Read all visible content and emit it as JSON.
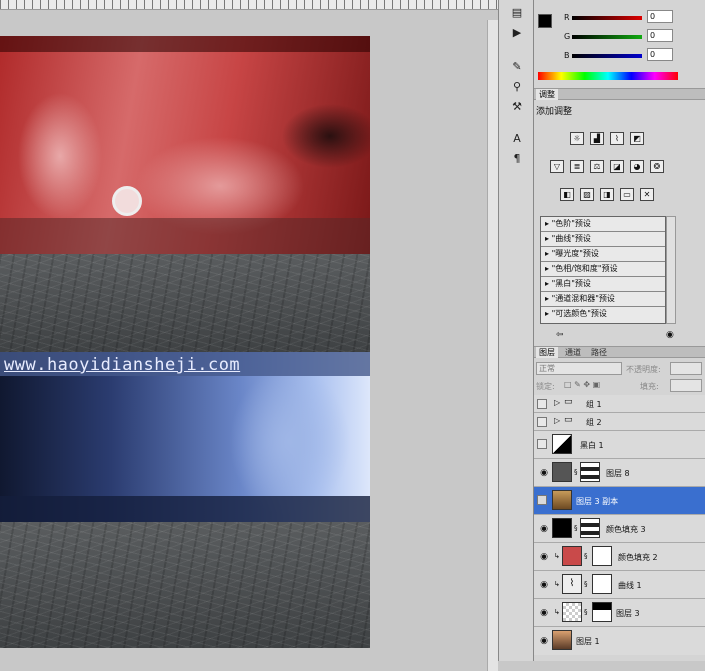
{
  "canvas": {
    "watermark": "www.haoyidiansheji.com"
  },
  "tools": {
    "icons": [
      "history-icon",
      "actions-icon",
      "brush-presets-icon",
      "clone-source-icon",
      "tool-presets-icon",
      "character-icon",
      "paragraph-icon"
    ]
  },
  "color_panel": {
    "fg_color": "#000000",
    "bg_color": "#ffffff",
    "channels": [
      {
        "label": "R",
        "value": "0"
      },
      {
        "label": "G",
        "value": "0"
      },
      {
        "label": "B",
        "value": "0"
      }
    ]
  },
  "adjustments_panel": {
    "tab": "调整",
    "title": "添加调整",
    "presets": [
      "\"色阶\"预设",
      "\"曲线\"预设",
      "\"曝光度\"预设",
      "\"色相/饱和度\"预设",
      "\"黑白\"预设",
      "\"通道混和器\"预设",
      "\"可选颜色\"预设"
    ]
  },
  "layers_panel": {
    "tabs": [
      "图层",
      "通道",
      "路径"
    ],
    "blend_mode": "正常",
    "opacity_label": "不透明度:",
    "lock_label": "锁定:",
    "fill_label": "填充:",
    "layers": [
      {
        "name": "组 1",
        "visible": false,
        "type": "group"
      },
      {
        "name": "组 2",
        "visible": false,
        "type": "group"
      },
      {
        "name": "黑白 1",
        "visible": false,
        "type": "adjustment"
      },
      {
        "name": "图层 8",
        "visible": true,
        "type": "masked"
      },
      {
        "name": "图层 3 副本",
        "visible": false,
        "type": "selected"
      },
      {
        "name": "颜色填充 3",
        "visible": true,
        "type": "fill"
      },
      {
        "name": "颜色填充 2",
        "visible": true,
        "type": "fill"
      },
      {
        "name": "曲线 1",
        "visible": true,
        "type": "adjustment"
      },
      {
        "name": "图层 3",
        "visible": true,
        "type": "masked"
      },
      {
        "name": "图层 1",
        "visible": true,
        "type": "photo"
      }
    ]
  }
}
